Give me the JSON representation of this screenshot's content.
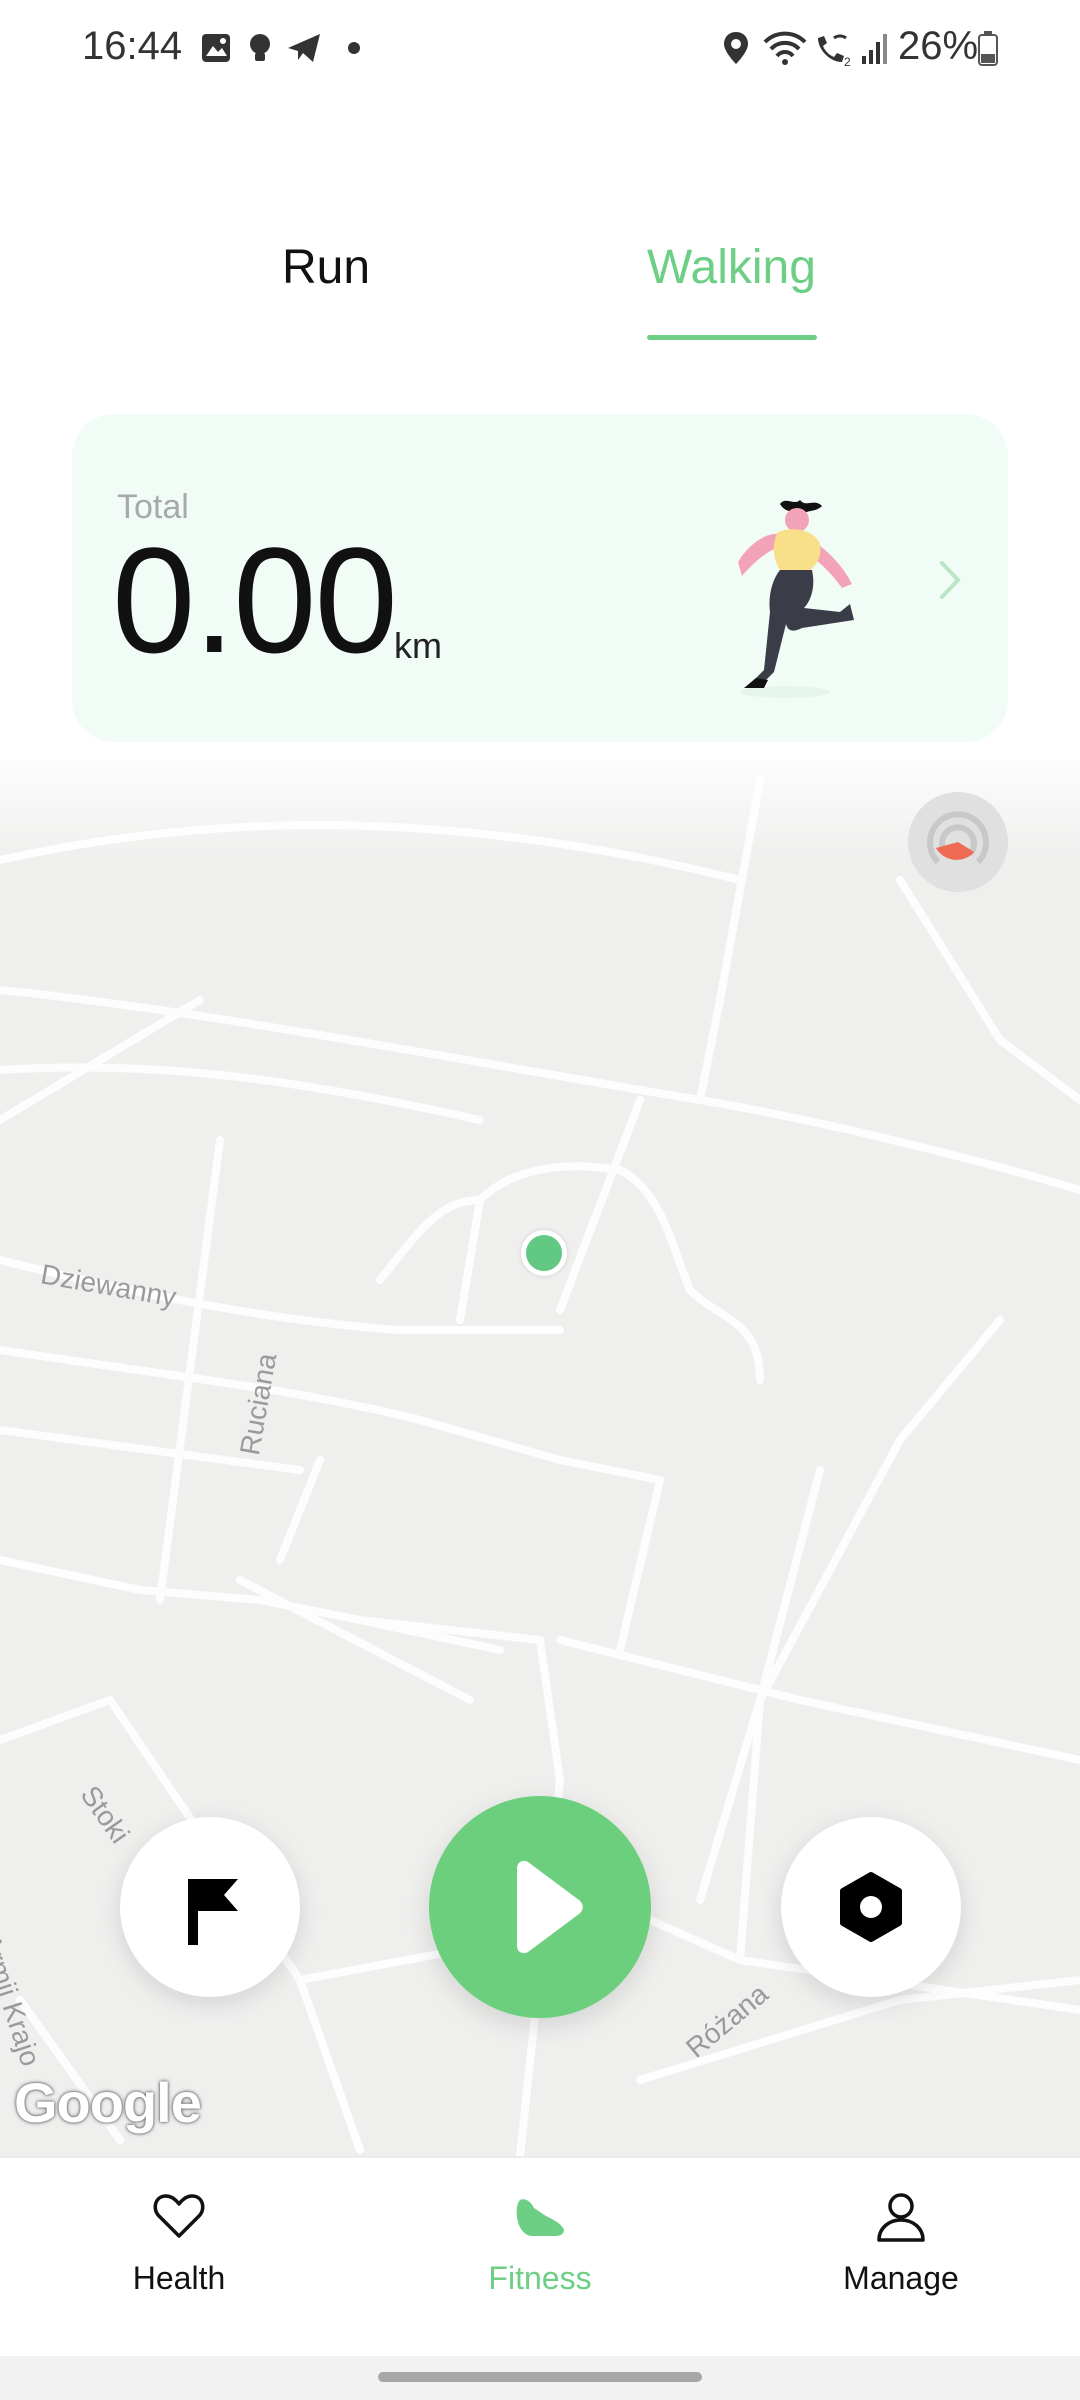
{
  "status_bar": {
    "time": "16:44",
    "battery": "26%",
    "left_icons": [
      "gallery-icon",
      "bulb-icon",
      "telegram-icon",
      "dot-icon"
    ],
    "right_icons": [
      "location-icon",
      "wifi-icon",
      "wifi-call-icon",
      "signal-icon",
      "battery-icon"
    ]
  },
  "tabs": [
    {
      "label": "Run",
      "active": false
    },
    {
      "label": "Walking",
      "active": true
    }
  ],
  "summary": {
    "label": "Total",
    "value": "0.00",
    "unit": "km"
  },
  "map": {
    "street_labels": [
      "Dziewanny",
      "Ruciana",
      "Stoki",
      "Armii Krajo",
      "Różana"
    ],
    "attribution": "Google"
  },
  "controls": {
    "left": "flag-icon",
    "center": "play-icon",
    "right": "settings-icon"
  },
  "bottom_nav": [
    {
      "label": "Health",
      "icon": "heart-icon",
      "active": false
    },
    {
      "label": "Fitness",
      "icon": "shoe-icon",
      "active": true
    },
    {
      "label": "Manage",
      "icon": "person-icon",
      "active": false
    }
  ],
  "colors": {
    "accent": "#6dcf85",
    "card_bg": "#f2fcf6",
    "map_bg": "#efefee"
  }
}
